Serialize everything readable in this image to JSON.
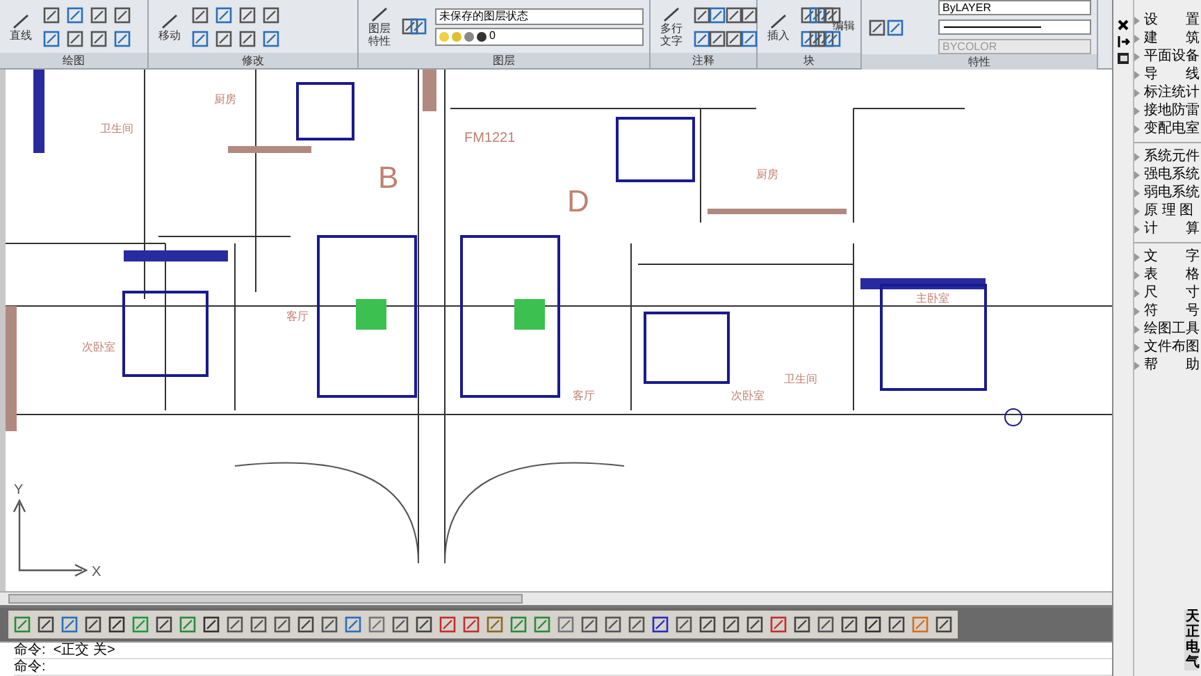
{
  "ribbon": {
    "panels": [
      {
        "title": "绘图",
        "big_buttons": [
          "直线"
        ]
      },
      {
        "title": "修改",
        "big_buttons": [
          "移动"
        ]
      },
      {
        "title": "图层",
        "big_buttons": [
          "图层特性"
        ],
        "layer_state": "未保存的图层状态",
        "layer_name": "0"
      },
      {
        "title": "注释",
        "big_buttons": [
          "多行文字"
        ]
      },
      {
        "title": "块",
        "big_buttons": [
          "插入"
        ],
        "small_buttons": [
          "编辑"
        ]
      },
      {
        "title": "特性",
        "color_combo": "ByLAYER",
        "plot_style": "BYCOLOR"
      }
    ]
  },
  "drawing": {
    "room_labels": [
      "厨房",
      "卫生间",
      "B",
      "FM1221",
      "D",
      "厨房",
      "客厅",
      "次卧室",
      "主卧室",
      "客厅",
      "次卧室",
      "卫生间"
    ],
    "axis_labels": [
      "X",
      "Y"
    ]
  },
  "sidebar": {
    "title": "天正电气",
    "groups": [
      [
        "设　　置",
        "建　　筑",
        "平面设备",
        "导　　线",
        "标注统计",
        "接地防雷",
        "变配电室"
      ],
      [
        "系统元件",
        "强电系统",
        "弱电系统",
        "原 理 图",
        "计　　算"
      ],
      [
        "文　　字",
        "表　　格",
        "尺　　寸",
        "符　　号",
        "绘图工具",
        "文件布图",
        "帮　　助"
      ]
    ]
  },
  "command_lines": [
    "命令:  <正交 关>",
    "命令:"
  ]
}
